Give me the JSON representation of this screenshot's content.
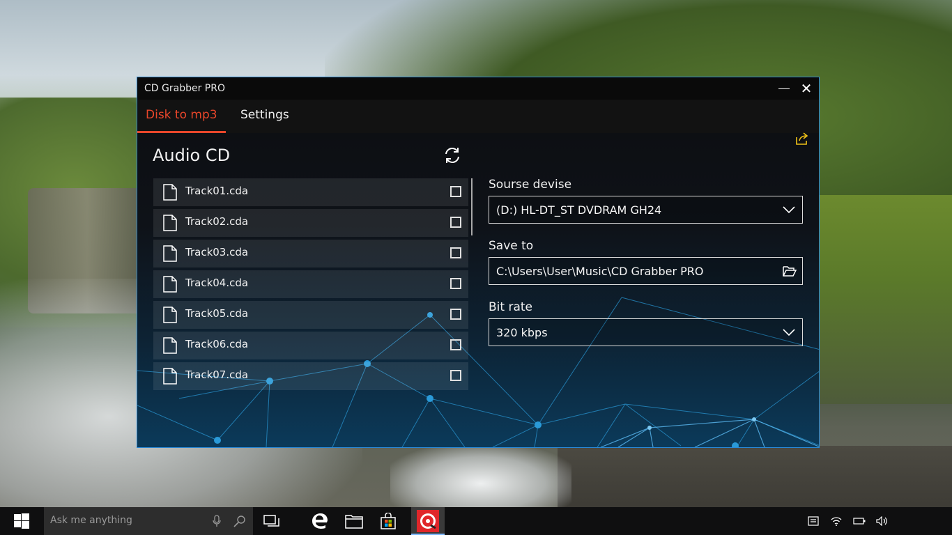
{
  "window": {
    "title": "CD Grabber PRO"
  },
  "tabs": [
    {
      "label": "Disk to mp3",
      "active": true
    },
    {
      "label": "Settings",
      "active": false
    }
  ],
  "main": {
    "heading": "Audio CD",
    "tracks": [
      {
        "name": "Track01.cda",
        "checked": false
      },
      {
        "name": "Track02.cda",
        "checked": false
      },
      {
        "name": "Track03.cda",
        "checked": false
      },
      {
        "name": "Track04.cda",
        "checked": false
      },
      {
        "name": "Track05.cda",
        "checked": false
      },
      {
        "name": "Track06.cda",
        "checked": false
      },
      {
        "name": "Track07.cda",
        "checked": false
      }
    ]
  },
  "settings_panel": {
    "source_label": "Sourse devise",
    "source_value": "(D:) HL-DT_ST DVDRAM GH24",
    "save_label": "Save to",
    "save_value": "C:\\Users\\User\\Music\\CD Grabber PRO",
    "bitrate_label": "Bit rate",
    "bitrate_value": "320 kbps"
  },
  "taskbar": {
    "search_placeholder": "Ask me anything"
  },
  "colors": {
    "accent": "#e8462a",
    "window_border": "#2a8ad8",
    "share_icon": "#f2c318"
  }
}
